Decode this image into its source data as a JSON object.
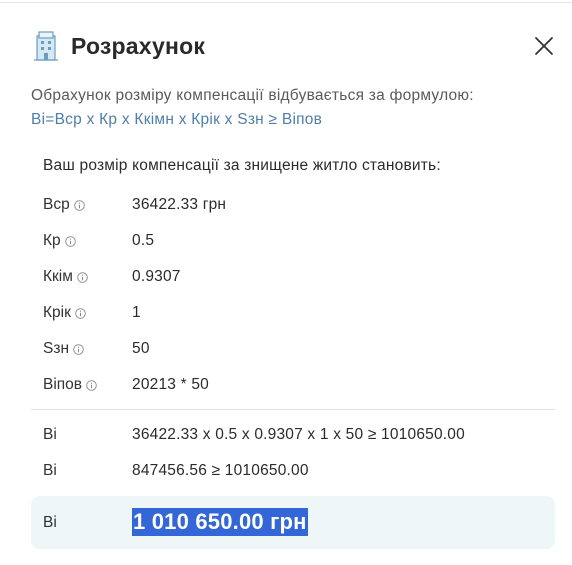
{
  "header": {
    "title": "Розрахунок",
    "icon": "building-icon",
    "close_icon": "close-icon"
  },
  "formula": {
    "intro": "Обрахунок розміру компенсації відбувається за формулою:",
    "expression": "Ві=Вср х Кр х Ккімн х Крік х Sзн ≥ Віпов"
  },
  "result": {
    "heading": "Ваш розмір компенсації за знищене житло становить:",
    "params": [
      {
        "name": "Вср",
        "value": "36422.33 грн"
      },
      {
        "name": "Кр",
        "value": "0.5"
      },
      {
        "name": "Ккім",
        "value": "0.9307"
      },
      {
        "name": "Крік",
        "value": "1"
      },
      {
        "name": "Sзн",
        "value": "50"
      },
      {
        "name": "Віпов",
        "value": "20213 * 50"
      }
    ],
    "calculation": [
      {
        "label": "Ві",
        "value": "36422.33 х 0.5 х 0.9307 х 1 х 50 ≥ 1010650.00"
      },
      {
        "label": "Ві",
        "value": "847456.56 ≥ 1010650.00"
      }
    ],
    "total": {
      "label": "Ві",
      "value": "1 010 650.00 грн"
    }
  },
  "colors": {
    "formula_accent": "#4f7fa8",
    "total_background": "#eef6f8",
    "selection_highlight": "#3366d6"
  }
}
